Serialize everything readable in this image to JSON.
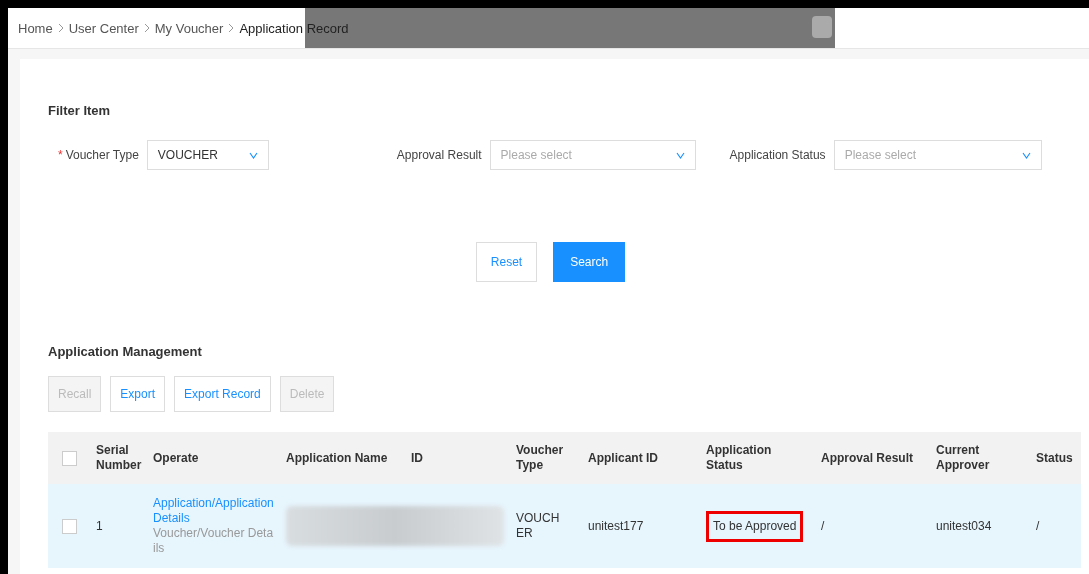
{
  "breadcrumb": [
    "Home",
    "User Center",
    "My Voucher",
    "Application Record"
  ],
  "filter": {
    "title": "Filter Item",
    "fields": [
      {
        "label": "Voucher Type",
        "required": true,
        "required_mark": "*",
        "value": "VOUCHER"
      },
      {
        "label": "Approval Result",
        "required": false,
        "placeholder": "Please select"
      },
      {
        "label": "Application Status",
        "required": false,
        "placeholder": "Please select"
      }
    ],
    "buttons": [
      {
        "label": "Reset",
        "kind": "default"
      },
      {
        "label": "Search",
        "kind": "primary"
      }
    ]
  },
  "management": {
    "title": "Application Management",
    "buttons": [
      {
        "label": "Recall",
        "disabled": true
      },
      {
        "label": "Export",
        "disabled": false
      },
      {
        "label": "Export Record",
        "disabled": false
      },
      {
        "label": "Delete",
        "disabled": true
      }
    ]
  },
  "table": {
    "header_checked": false,
    "columns": [
      "Serial Number",
      "Operate",
      "Application Name",
      "ID",
      "Voucher Type",
      "Applicant ID",
      "Application Status",
      "Approval Result",
      "Current Approver",
      "Status"
    ],
    "rows": [
      {
        "selected": true,
        "checked": false,
        "serial_number": "1",
        "operate": [
          {
            "label": "Application/Application Details",
            "kind": "primary"
          },
          {
            "label": "Voucher/Voucher Details",
            "kind": "secondary"
          }
        ],
        "voucher_type": "VOUCHER",
        "applicant_id": "unitest177",
        "application_status": "To be Approved",
        "status_highlighted": true,
        "approval_result": "/",
        "current_approver": "unitest034",
        "status": "/"
      }
    ]
  }
}
